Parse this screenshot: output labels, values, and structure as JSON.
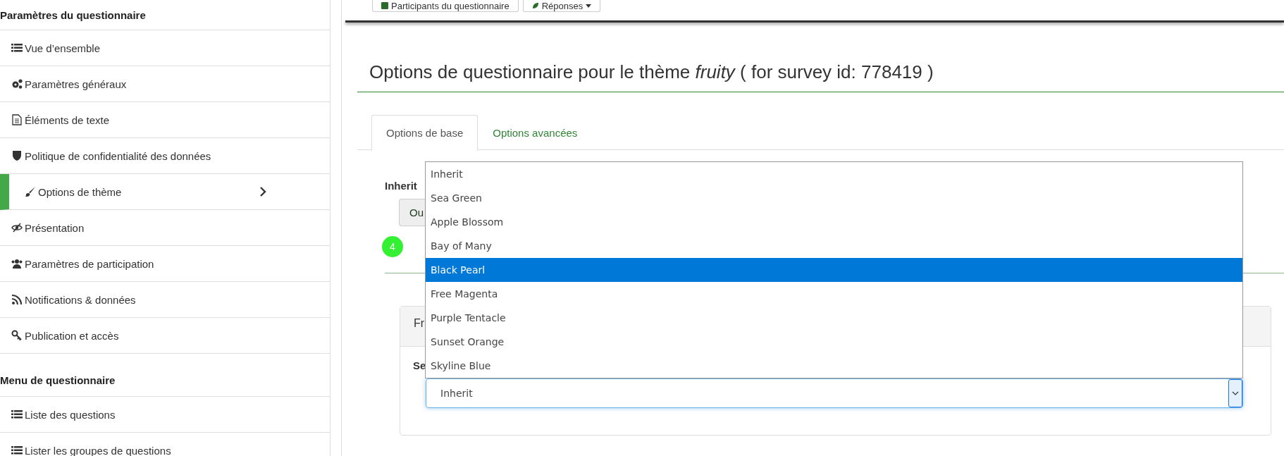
{
  "toolbar_buttons": [
    {
      "label": "Participants du questionnaire"
    },
    {
      "label": "Réponses"
    }
  ],
  "sidebar": [
    {
      "title": "Paramètres du questionnaire",
      "items": [
        {
          "label": "Vue d’ensemble",
          "selected": false
        },
        {
          "label": "Paramètres généraux",
          "selected": false
        },
        {
          "label": "Éléments de texte",
          "selected": false
        },
        {
          "label": "Politique de confidentialité des données",
          "selected": false
        },
        {
          "label": "Options de thème",
          "selected": true
        },
        {
          "label": "Présentation",
          "selected": false
        },
        {
          "label": "Paramètres de participation",
          "selected": false
        },
        {
          "label": "Notifications & données",
          "selected": false
        },
        {
          "label": "Publication et accès",
          "selected": false
        }
      ]
    },
    {
      "title": "Menu de questionnaire",
      "items": [
        {
          "label": "Liste des questions",
          "selected": false
        },
        {
          "label": "Lister les groupes de questions",
          "selected": false
        }
      ]
    }
  ],
  "page_title": "Options de questionnaire pour le thème *fruity* ( for survey id: 778419 )",
  "tabs": [
    {
      "label": "Options de base",
      "selected": true
    },
    {
      "label": "Options avancées",
      "selected": false
    }
  ],
  "inherit_label": "Inherit",
  "inherit_button": "Ou",
  "badge": "4",
  "panel": {
    "header": "Fr",
    "field_label": "Se",
    "select": {
      "value": "Inherit",
      "expanded": true,
      "options": [
        {
          "label": "Inherit",
          "highlighted": false
        },
        {
          "label": "Sea Green",
          "highlighted": false
        },
        {
          "label": "Apple Blossom",
          "highlighted": false
        },
        {
          "label": "Bay of Many",
          "highlighted": false
        },
        {
          "label": "Black Pearl",
          "highlighted": true
        },
        {
          "label": "Free Magenta",
          "highlighted": false
        },
        {
          "label": "Purple Tentacle",
          "highlighted": false
        },
        {
          "label": "Sunset Orange",
          "highlighted": false
        },
        {
          "label": "Skyline Blue",
          "highlighted": false
        }
      ]
    }
  }
}
